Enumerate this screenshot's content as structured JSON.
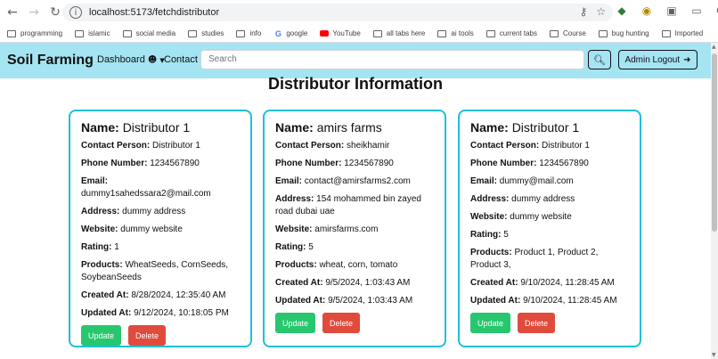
{
  "browser": {
    "url": "localhost:5173/fetchdistributor",
    "bookmarks": [
      {
        "label": "programming",
        "icon": "folder"
      },
      {
        "label": "islamic",
        "icon": "folder"
      },
      {
        "label": "social media",
        "icon": "folder"
      },
      {
        "label": "studies",
        "icon": "folder"
      },
      {
        "label": "info",
        "icon": "folder"
      },
      {
        "label": "google",
        "icon": "google"
      },
      {
        "label": "YouTube",
        "icon": "youtube"
      },
      {
        "label": "all tabs here",
        "icon": "folder"
      },
      {
        "label": "ai tools",
        "icon": "folder"
      },
      {
        "label": "current tabs",
        "icon": "folder"
      },
      {
        "label": "Course",
        "icon": "folder"
      },
      {
        "label": "bug hunting",
        "icon": "folder"
      },
      {
        "label": "Imported",
        "icon": "folder"
      }
    ]
  },
  "navbar": {
    "brand": "Soil Farming",
    "dashboard": "Dashboard",
    "contact": "Contact",
    "search_placeholder": "Search",
    "logout": "Admin Logout"
  },
  "page": {
    "title": "Distributor Information"
  },
  "labels": {
    "name": "Name:",
    "contact_person": "Contact Person:",
    "phone": "Phone Number:",
    "email": "Email:",
    "address": "Address:",
    "website": "Website:",
    "rating": "Rating:",
    "products": "Products:",
    "created": "Created At:",
    "updated": "Updated At:",
    "update_btn": "Update",
    "delete_btn": "Delete"
  },
  "distributors": [
    {
      "name": "Distributor 1",
      "contact_person": "Distributor 1",
      "phone": "1234567890",
      "email": "dummy1sahedssara2@mail.com",
      "address": "dummy address",
      "website": "dummy website",
      "rating": "1",
      "products": "WheatSeeds, CornSeeds, SoybeanSeeds",
      "created": "8/28/2024, 12:35:40 AM",
      "updated": "9/12/2024, 10:18:05 PM"
    },
    {
      "name": "amirs farms",
      "contact_person": "sheikhamir",
      "phone": "1234567890",
      "email": "contact@amirsfarms2.com",
      "address": "154 mohammed bin zayed road dubai uae",
      "website": "amirsfarms.com",
      "rating": "5",
      "products": "wheat, corn, tomato",
      "created": "9/5/2024, 1:03:43 AM",
      "updated": "9/5/2024, 1:03:43 AM"
    },
    {
      "name": "Distributor 1",
      "contact_person": "Distributor 1",
      "phone": "1234567890",
      "email": "dummy@mail.com",
      "address": "dummy address",
      "website": "dummy website",
      "rating": "5",
      "products": "Product 1, Product 2, Product 3,",
      "created": "9/10/2024, 11:28:45 AM",
      "updated": "9/10/2024, 11:28:45 AM"
    }
  ]
}
